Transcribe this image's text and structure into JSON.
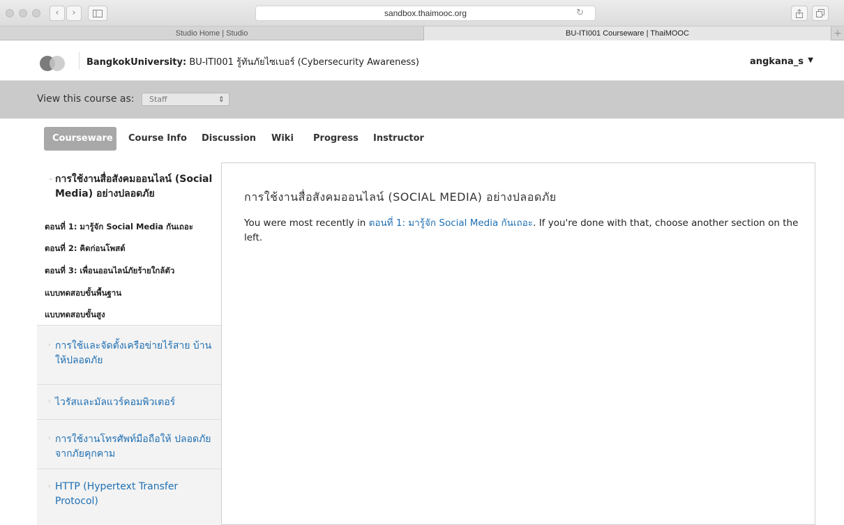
{
  "browser": {
    "url": "sandbox.thaimooc.org",
    "tabs": [
      {
        "label": "Studio Home | Studio",
        "active": false
      },
      {
        "label": "BU-ITI001 Courseware | ThaiMOOC",
        "active": true
      }
    ],
    "back_icon": "‹",
    "forward_icon": "›",
    "reload_icon": "↻",
    "tab_plus": "+"
  },
  "header": {
    "org": "BangkokUniversity:",
    "course": "BU-ITI001 รู้ทันภัยไซเบอร์ (Cybersecurity Awareness)",
    "username": "angkana_s",
    "user_caret": "▼"
  },
  "view_as": {
    "label": "View this course as:",
    "selected": "Staff",
    "arrows": "⇕"
  },
  "course_tabs": [
    "Courseware",
    "Course Info",
    "Discussion",
    "Wiki",
    "Progress",
    "Instructor"
  ],
  "sidebar": {
    "open_chapter": {
      "title": "การใช้งานสื่อสังคมออนไลน์ (Social Media) อย่างปลอดภัย",
      "chevron": "⌄",
      "sections": [
        "ตอนที่ 1: มารู้จัก Social Media กันเถอะ",
        "ตอนที่ 2: คิดก่อนโพสต์",
        "ตอนที่ 3: เพื่อนออนไลน์ภัยร้ายใกล้ตัว",
        "แบบทดสอบขั้นพื้นฐาน",
        "แบบทดสอบขั้นสูง"
      ]
    },
    "chapters": [
      "การใช้และจัดตั้งเครือข่ายไร้สาย บ้านให้ปลอดภัย",
      "ไวรัสและมัลแวร์คอมพิวเตอร์",
      "การใช้งานโทรศัพท์มือถือให้ ปลอดภัยจากภัยคุกคาม",
      "HTTP (Hypertext Transfer Protocol)"
    ],
    "closed_chevron": "›"
  },
  "content": {
    "heading": "การใช้งานสื่อสังคมออนไลน์ (SOCIAL MEDIA) อย่างปลอดภัย",
    "text_before": "You were most recently in ",
    "link": "ตอนที่ 1: มารู้จัก Social Media กันเถอะ",
    "text_after": ". If you're done with that, choose another section on the left."
  }
}
